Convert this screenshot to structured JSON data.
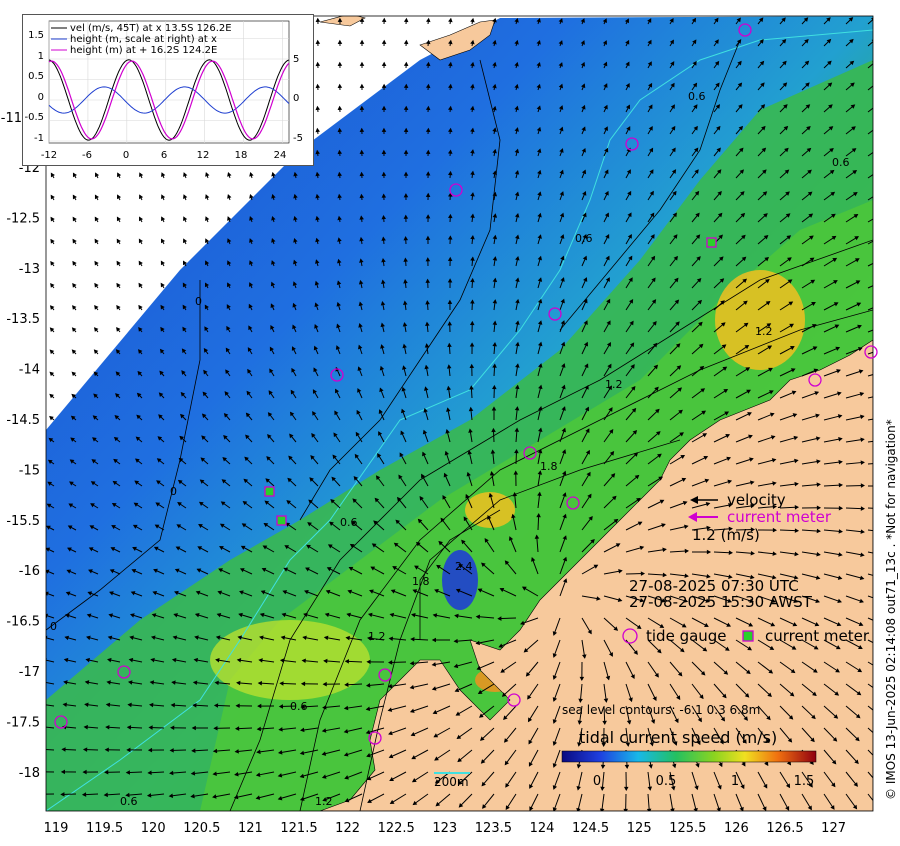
{
  "map": {
    "x_ticks": [
      "119",
      "119.5",
      "120",
      "120.5",
      "121",
      "121.5",
      "122",
      "122.5",
      "123",
      "123.5",
      "124",
      "124.5",
      "125",
      "125.5",
      "126",
      "126.5",
      "127"
    ],
    "y_ticks": [
      "-12",
      "-12.5",
      "-13",
      "-13.5",
      "-14",
      "-14.5",
      "-15",
      "-15.5",
      "-16",
      "-16.5",
      "-17",
      "-17.5",
      "-18"
    ],
    "y_partial_label": "-11"
  },
  "contour_labels": [
    "0",
    "0",
    "0",
    "0.6",
    "0.6",
    "0.6",
    "0.6",
    "0.6",
    "1.2",
    "1.2",
    "1.2",
    "1.8",
    "1.8",
    "2.4",
    "0.6",
    "1.2"
  ],
  "legend": {
    "velocity_label": "velocity",
    "current_meter_label": "current meter",
    "scale_label": "1.2 (m/s)",
    "time_utc": "27-08-2025 07:30 UTC",
    "time_awst": "27-08-2025 15:30 AWST",
    "tide_gauge_label": "tide gauge",
    "current_meter_key_label": "current meter",
    "sea_level_contours": "sea level contours: -6.1 0.3 6.8m",
    "colorbar_title": "tidal current speed (m/s)",
    "colorbar_ticks": [
      "0",
      "0.5",
      "1",
      "1.5"
    ],
    "depth_label": "200m"
  },
  "inset": {
    "legend": [
      "vel (m/s, 45T) at x 13.5S 126.2E",
      "height (m, scale at right) at x",
      "height (m) at + 16.2S 124.2E"
    ],
    "y_left_ticks": [
      "1.5",
      "1",
      "0.5",
      "0",
      "-0.5",
      "-1"
    ],
    "y_right_ticks": [
      "5",
      "0",
      "-5"
    ],
    "x_ticks": [
      "-12",
      "-6",
      "0",
      "6",
      "12",
      "18",
      "24"
    ],
    "colors": {
      "vel": "#000000",
      "height_x": "#1f3fd0",
      "height_plus": "#d000d0"
    }
  },
  "credit": "© IMOS 13-Jun-2025 02:14:08 out71_13c . *Not for navigation*",
  "colors": {
    "land": "#f7c99c",
    "deep": "#1e5fd8",
    "shelf": "#2ab84a",
    "coast_hot": "#f0c020",
    "tide_gauge": "#d000d0",
    "current_meter": "#2ad02a",
    "arrow": "#000000",
    "isobath": "#40e0e0"
  }
}
